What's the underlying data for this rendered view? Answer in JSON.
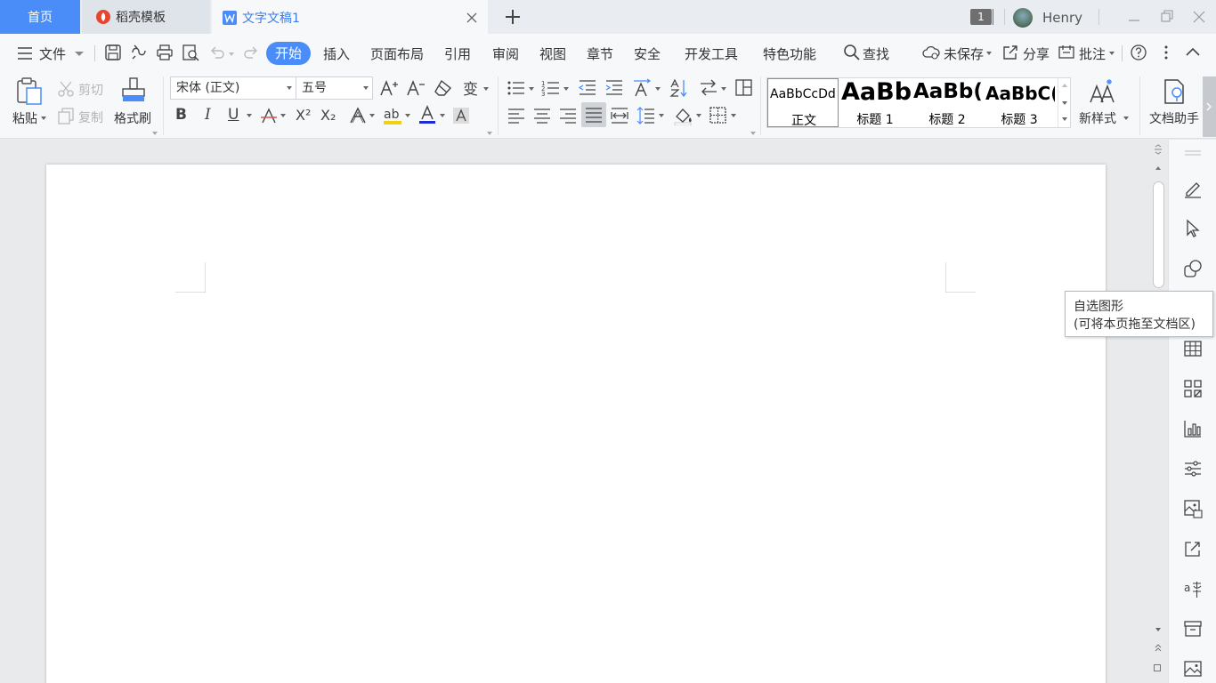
{
  "tabs": {
    "home": "首页",
    "templates": "稻壳模板",
    "document": "文字文稿1"
  },
  "titlebar": {
    "window_count": "1",
    "user_name": "Henry"
  },
  "menu": {
    "file": "文件",
    "items": [
      "开始",
      "插入",
      "页面布局",
      "引用",
      "审阅",
      "视图",
      "章节",
      "安全",
      "开发工具",
      "特色功能"
    ],
    "search": "查找",
    "unsaved": "未保存",
    "share": "分享",
    "comment": "批注"
  },
  "ribbon": {
    "paste": "粘贴",
    "cut": "剪切",
    "copy": "复制",
    "format_painter": "格式刷",
    "font_name": "宋体 (正文)",
    "font_size": "五号",
    "bold": "B",
    "italic": "I",
    "underline": "U",
    "superscript": "X²",
    "subscript": "X₂",
    "new_style": "新样式",
    "doc_assistant": "文档助手"
  },
  "styles": [
    {
      "sample": "AaBbCcDd",
      "name": "正文"
    },
    {
      "sample": "AaBb",
      "name": "标题 1"
    },
    {
      "sample": "AaBb(",
      "name": "标题 2"
    },
    {
      "sample": "AaBbC(",
      "name": "标题 3"
    }
  ],
  "tooltip": {
    "line1": "自选图形",
    "line2": "(可将本页拖至文档区)"
  },
  "colors": {
    "accent": "#4a8df8",
    "highlight": "#f2d20f",
    "font_color": "#1d2cd8",
    "strike": "#d9534f"
  }
}
